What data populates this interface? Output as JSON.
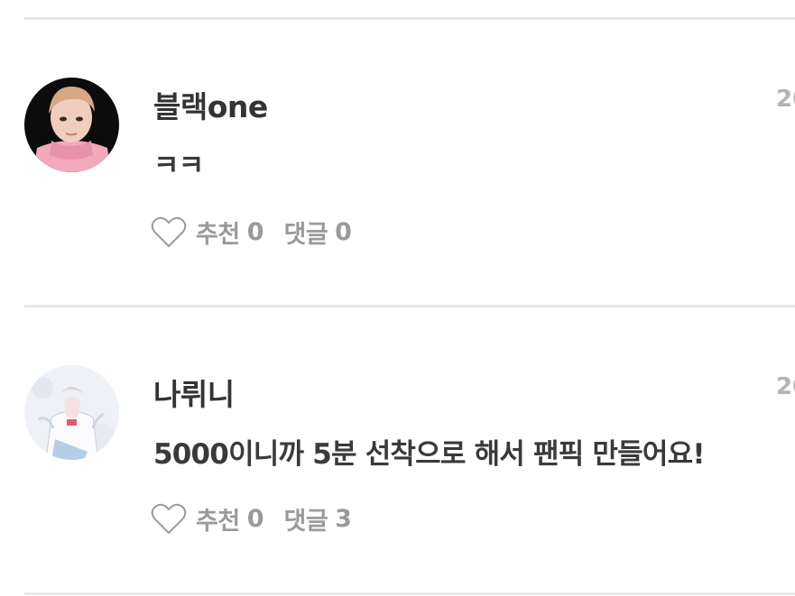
{
  "comments": [
    {
      "username": "블랙one",
      "date": "20",
      "text": "ㅋㅋ",
      "like_label": "추천",
      "like_count": "0",
      "reply_label": "댓글",
      "reply_count": "0",
      "avatar_icon": "user-avatar-icon"
    },
    {
      "username": "나뤼니",
      "date": "20",
      "text": "5000이니까 5분 선착으로 해서 팬픽 만들어요!",
      "like_label": "추천",
      "like_count": "0",
      "reply_label": "댓글",
      "reply_count": "3",
      "avatar_icon": "user-avatar-icon"
    }
  ],
  "icons": {
    "like": "heart-outline-icon"
  },
  "colors": {
    "username": "#333333",
    "meta": "#9a9a9a",
    "date": "#b4b4b4",
    "divider": "#e8e8e8"
  }
}
